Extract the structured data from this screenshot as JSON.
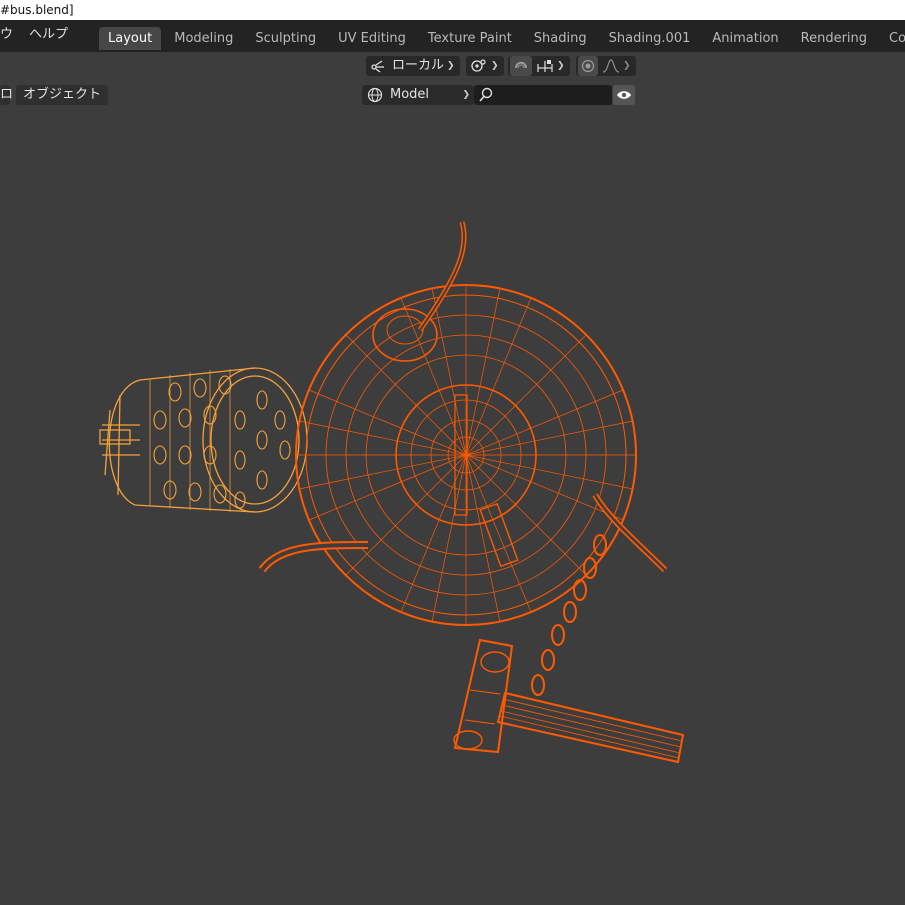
{
  "window": {
    "title": "#bus.blend]"
  },
  "menubar": {
    "window_menu_fragment": "ウ",
    "help_menu": "ヘルプ",
    "tabs": [
      {
        "label": "Layout",
        "active": true
      },
      {
        "label": "Modeling",
        "active": false
      },
      {
        "label": "Sculpting",
        "active": false
      },
      {
        "label": "UV Editing",
        "active": false
      },
      {
        "label": "Texture Paint",
        "active": false
      },
      {
        "label": "Shading",
        "active": false
      },
      {
        "label": "Shading.001",
        "active": false
      },
      {
        "label": "Animation",
        "active": false
      },
      {
        "label": "Rendering",
        "active": false
      },
      {
        "label": "Com",
        "active": false
      }
    ]
  },
  "toolbar": {
    "transform_orientation": "ローカル",
    "pivot_icon": "pivot-icon",
    "snap_icon": "snap-magnet-icon",
    "snap_increment_icon": "snap-increment-icon",
    "proportional_icon": "proportional-edit-icon",
    "falloff_icon": "falloff-curve-icon"
  },
  "header": {
    "view_fragment": "ロ",
    "object_menu": "オブジェクト",
    "display_mode": "Model",
    "search_placeholder": "",
    "visibility_icon": "eye-icon"
  },
  "colors": {
    "accent": "#4a4a4a",
    "viewport_bg": "#3d3d3d",
    "selected_wire": "#ff5a00",
    "active_wire": "#f6a23a"
  }
}
